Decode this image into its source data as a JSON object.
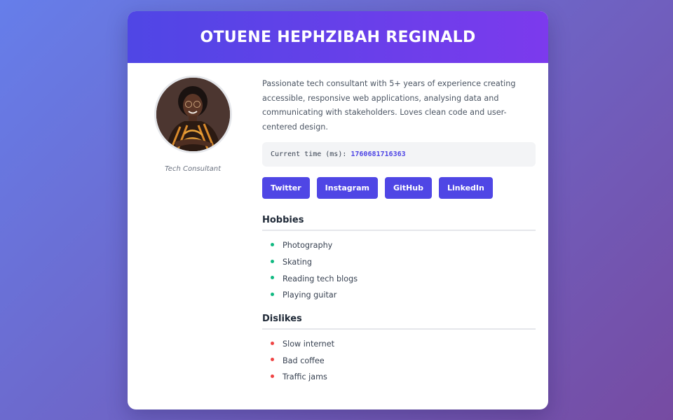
{
  "profile": {
    "name": "OTUENE HEPHZIBAH REGINALD",
    "role": "Tech Consultant",
    "bio": "Passionate tech consultant with 5+ years of experience creating accessible, responsive web applications, analysing data and communicating with stakeholders. Loves clean code and user-centered design.",
    "time_label": "Current time (ms):",
    "time_value": "1760681716363"
  },
  "socials": [
    {
      "label": "Twitter"
    },
    {
      "label": "Instagram"
    },
    {
      "label": "GitHub"
    },
    {
      "label": "LinkedIn"
    }
  ],
  "hobbies": {
    "title": "Hobbies",
    "items": [
      "Photography",
      "Skating",
      "Reading tech blogs",
      "Playing guitar"
    ]
  },
  "dislikes": {
    "title": "Dislikes",
    "items": [
      "Slow internet",
      "Bad coffee",
      "Traffic jams"
    ]
  },
  "colors": {
    "accent": "#4f46e5",
    "hobby_bullet": "#10b981",
    "dislike_bullet": "#ef4444"
  }
}
